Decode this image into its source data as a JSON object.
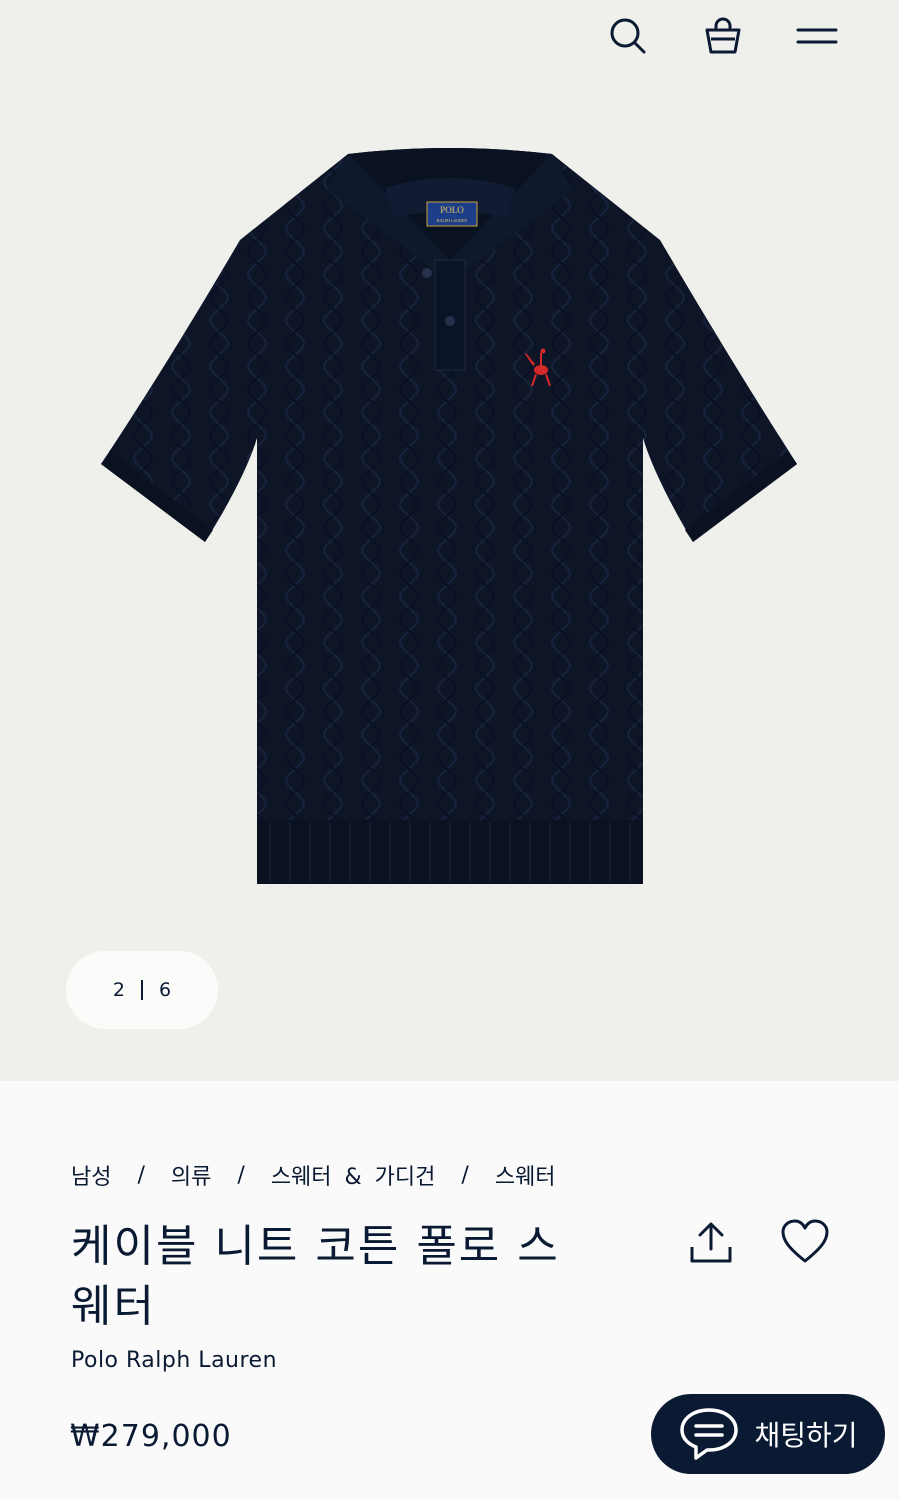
{
  "header": {
    "icons": [
      "search-icon",
      "shopping-bag-icon",
      "menu-icon"
    ]
  },
  "gallery": {
    "current": "2",
    "total": "6",
    "label_badge_line1": "POLO",
    "label_badge_line2": "RALPH LAUREN"
  },
  "breadcrumb": {
    "items": [
      "남성",
      "의류",
      "스웨터 & 가디건",
      "스웨터"
    ],
    "separator": "/"
  },
  "product": {
    "title_line1": "케이블 니트 코튼 폴로 스",
    "title_line2": "웨터",
    "brand": "Polo Ralph Lauren",
    "price": "₩279,000"
  },
  "chat": {
    "label": "채팅하기"
  },
  "colors": {
    "navy": "#0b1a33",
    "hero_bg": "#efefec",
    "logo_red": "#d42a2a"
  }
}
